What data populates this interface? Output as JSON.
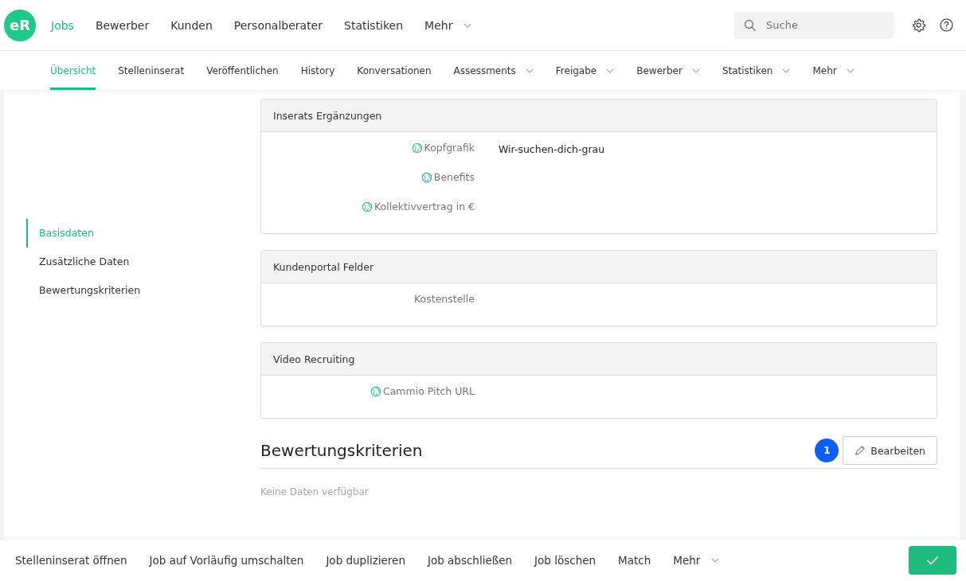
{
  "logo": "eR",
  "main_nav": [
    {
      "label": "Jobs",
      "selected": true,
      "dropdown": false
    },
    {
      "label": "Bewerber",
      "selected": false,
      "dropdown": false
    },
    {
      "label": "Kunden",
      "selected": false,
      "dropdown": false
    },
    {
      "label": "Personalberater",
      "selected": false,
      "dropdown": false
    },
    {
      "label": "Statistiken",
      "selected": false,
      "dropdown": false
    },
    {
      "label": "Mehr",
      "selected": false,
      "dropdown": true
    }
  ],
  "search": {
    "placeholder": "Suche"
  },
  "sub_nav": [
    {
      "label": "Übersicht",
      "selected": true,
      "dropdown": false
    },
    {
      "label": "Stelleninserat",
      "selected": false,
      "dropdown": false
    },
    {
      "label": "Veröffentlichen",
      "selected": false,
      "dropdown": false
    },
    {
      "label": "History",
      "selected": false,
      "dropdown": false
    },
    {
      "label": "Konversationen",
      "selected": false,
      "dropdown": false
    },
    {
      "label": "Assessments",
      "selected": false,
      "dropdown": true
    },
    {
      "label": "Freigabe",
      "selected": false,
      "dropdown": true
    },
    {
      "label": "Bewerber",
      "selected": false,
      "dropdown": true
    },
    {
      "label": "Statistiken",
      "selected": false,
      "dropdown": true
    },
    {
      "label": "Mehr",
      "selected": false,
      "dropdown": true
    }
  ],
  "sidebar": {
    "items": [
      {
        "label": "Basisdaten",
        "selected": true
      },
      {
        "label": "Zusätzliche Daten",
        "selected": false
      },
      {
        "label": "Bewertungskriterien",
        "selected": false
      }
    ]
  },
  "cards": [
    {
      "title": "Inserats Ergänzungen",
      "fields": [
        {
          "label": "Kopfgrafik",
          "translatable": true,
          "value": "Wir-suchen-dich-grau"
        },
        {
          "label": "Benefits",
          "translatable": true
        },
        {
          "label": "Kollektivvertrag in €",
          "translatable": true
        }
      ]
    },
    {
      "title": "Kundenportal Felder",
      "fields": [
        {
          "label": "Kostenstelle",
          "translatable": false
        }
      ]
    },
    {
      "title": "Video Recruiting",
      "fields": [
        {
          "label": "Cammio Pitch URL",
          "translatable": true
        }
      ]
    }
  ],
  "section": {
    "title": "Bewertungskriterien",
    "badge": "1",
    "edit_button": "Bearbeiten",
    "empty_text": "Keine Daten verfügbar"
  },
  "action_bar": [
    {
      "label": "Stelleninserat öffnen",
      "dropdown": false
    },
    {
      "label": "Job auf Vorläufig umschalten",
      "dropdown": false
    },
    {
      "label": "Job duplizieren",
      "dropdown": false
    },
    {
      "label": "Job abschließen",
      "dropdown": false
    },
    {
      "label": "Job löschen",
      "dropdown": false
    },
    {
      "label": "Match",
      "dropdown": false
    },
    {
      "label": "Mehr",
      "dropdown": true
    }
  ]
}
